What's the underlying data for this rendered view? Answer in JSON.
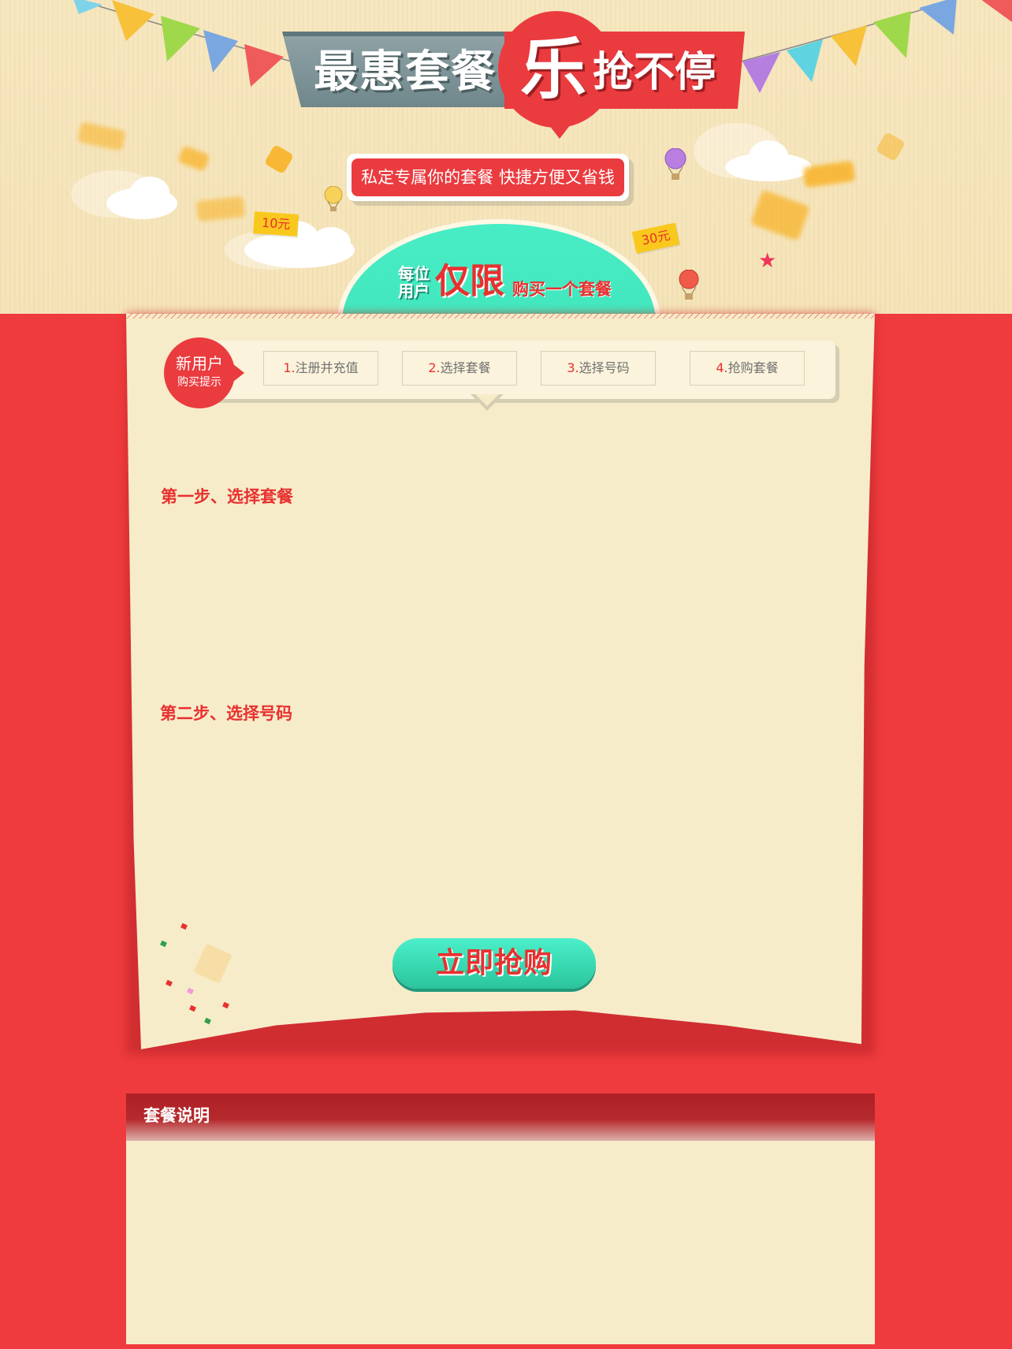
{
  "banner": {
    "title_left": "最惠套餐",
    "title_big_char": "乐",
    "title_right": "抢不停",
    "slogan": "私定专属你的套餐  快捷方便又省钱",
    "ticket_10": "10元",
    "ticket_30": "30元",
    "limit_small_line1": "每位",
    "limit_small_line2": "用户",
    "limit_big": "仅限",
    "limit_tail": "购买一个套餐"
  },
  "steps": {
    "hint_main": "新用户",
    "hint_sub": "购买提示",
    "items": [
      {
        "num": "1.",
        "label": "注册并充值"
      },
      {
        "num": "2.",
        "label": "选择套餐"
      },
      {
        "num": "3.",
        "label": "选择号码"
      },
      {
        "num": "4.",
        "label": "抢购套餐"
      }
    ]
  },
  "sections": {
    "step1_title": "第一步、选择套餐",
    "step2_title": "第二步、选择号码"
  },
  "buy_button": {
    "label": "立即抢购"
  },
  "description": {
    "title": "套餐说明"
  },
  "colors": {
    "page_red": "#ef3b3d",
    "brand_red": "#ea3b3f",
    "text_red": "#e8302f",
    "paper": "#f7ecca",
    "teal": "#3ee0b6",
    "ticket_yellow": "#f9c81c"
  }
}
